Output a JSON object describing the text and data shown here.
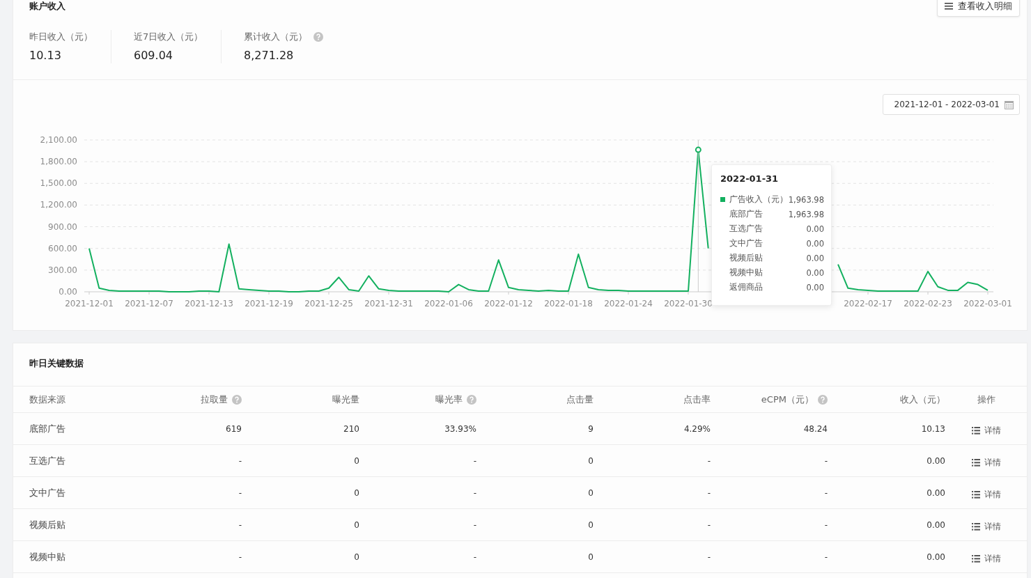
{
  "account_income": {
    "title": "账户收入",
    "detail_button": "查看收入明细",
    "summary": [
      {
        "label": "昨日收入（元）",
        "value": "10.13",
        "help": false
      },
      {
        "label": "近7日收入（元）",
        "value": "609.04",
        "help": false
      },
      {
        "label": "累计收入（元）",
        "value": "8,271.28",
        "help": true
      }
    ],
    "date_range": "2021-12-01 - 2022-03-01",
    "chart_data": {
      "type": "line",
      "grid": true,
      "ylim": [
        0,
        2100
      ],
      "categories": [
        "2021-12-01",
        null,
        null,
        null,
        null,
        null,
        "2021-12-07",
        null,
        null,
        null,
        null,
        null,
        "2021-12-13",
        null,
        null,
        null,
        null,
        null,
        "2021-12-19",
        null,
        null,
        null,
        null,
        null,
        "2021-12-25",
        null,
        null,
        null,
        null,
        null,
        "2021-12-31",
        null,
        null,
        null,
        null,
        null,
        "2022-01-06",
        null,
        null,
        null,
        null,
        null,
        "2022-01-12",
        null,
        null,
        null,
        null,
        null,
        "2022-01-18",
        null,
        null,
        null,
        null,
        null,
        "2022-01-24",
        null,
        null,
        null,
        null,
        null,
        "2022-01-30",
        null,
        null,
        null,
        null,
        null,
        null,
        null,
        null,
        null,
        null,
        null,
        null,
        null,
        null,
        null,
        null,
        null,
        "2022-02-17",
        null,
        null,
        null,
        null,
        null,
        "2022-02-23",
        null,
        null,
        null,
        null,
        null,
        "2022-03-01"
      ],
      "yticks": [
        {
          "value": 0,
          "label": "0.00"
        },
        {
          "value": 300,
          "label": "300.00"
        },
        {
          "value": 600,
          "label": "600.00"
        },
        {
          "value": 900,
          "label": "900.00"
        },
        {
          "value": 1200,
          "label": "1,200.00"
        },
        {
          "value": 1500,
          "label": "1,500.00"
        },
        {
          "value": 1800,
          "label": "1,800.00"
        },
        {
          "value": 2100,
          "label": "2,100.00"
        }
      ],
      "series": [
        {
          "color": "#13b05f",
          "values": [
            600,
            50,
            20,
            10,
            10,
            10,
            10,
            10,
            0,
            0,
            0,
            10,
            10,
            0,
            660,
            40,
            30,
            20,
            10,
            10,
            0,
            0,
            10,
            10,
            50,
            200,
            30,
            10,
            220,
            40,
            20,
            10,
            10,
            10,
            10,
            10,
            0,
            100,
            30,
            10,
            10,
            440,
            60,
            30,
            20,
            10,
            20,
            10,
            10,
            520,
            60,
            30,
            20,
            20,
            10,
            10,
            10,
            10,
            10,
            10,
            10,
            1963.98,
            600,
            null,
            null,
            null,
            null,
            null,
            null,
            null,
            null,
            null,
            null,
            null,
            null,
            380,
            50,
            30,
            20,
            10,
            10,
            10,
            10,
            10,
            280,
            70,
            20,
            20,
            130,
            100,
            20
          ]
        }
      ]
    },
    "tooltip": {
      "title": "2022-01-31",
      "rows": [
        {
          "label": "广告收入（元）",
          "value": "1,963.98",
          "marker": true
        },
        {
          "label": "底部广告",
          "value": "1,963.98",
          "marker": false
        },
        {
          "label": "互选广告",
          "value": "0.00",
          "marker": false
        },
        {
          "label": "文中广告",
          "value": "0.00",
          "marker": false
        },
        {
          "label": "视频后贴",
          "value": "0.00",
          "marker": false
        },
        {
          "label": "视频中贴",
          "value": "0.00",
          "marker": false
        },
        {
          "label": "返佣商品",
          "value": "0.00",
          "marker": false
        }
      ]
    }
  },
  "key_data": {
    "title": "昨日关键数据",
    "table": {
      "columns": [
        {
          "label": "数据来源",
          "help": false
        },
        {
          "label": "拉取量",
          "help": true
        },
        {
          "label": "曝光量",
          "help": false
        },
        {
          "label": "曝光率",
          "help": true
        },
        {
          "label": "点击量",
          "help": false
        },
        {
          "label": "点击率",
          "help": false
        },
        {
          "label": "eCPM（元）",
          "help": true
        },
        {
          "label": "收入（元）",
          "help": false
        },
        {
          "label": "操作",
          "help": false
        }
      ],
      "rows": [
        {
          "cells": [
            "底部广告",
            "619",
            "210",
            "33.93%",
            "9",
            "4.29%",
            "48.24",
            "10.13"
          ],
          "action": "详情"
        },
        {
          "cells": [
            "互选广告",
            "-",
            "0",
            "-",
            "0",
            "-",
            "-",
            "0.00"
          ],
          "action": "详情"
        },
        {
          "cells": [
            "文中广告",
            "-",
            "0",
            "-",
            "0",
            "-",
            "-",
            "0.00"
          ],
          "action": "详情"
        },
        {
          "cells": [
            "视频后贴",
            "-",
            "0",
            "-",
            "0",
            "-",
            "-",
            "0.00"
          ],
          "action": "详情"
        },
        {
          "cells": [
            "视频中贴",
            "-",
            "0",
            "-",
            "0",
            "-",
            "-",
            "0.00"
          ],
          "action": "详情"
        }
      ]
    }
  }
}
